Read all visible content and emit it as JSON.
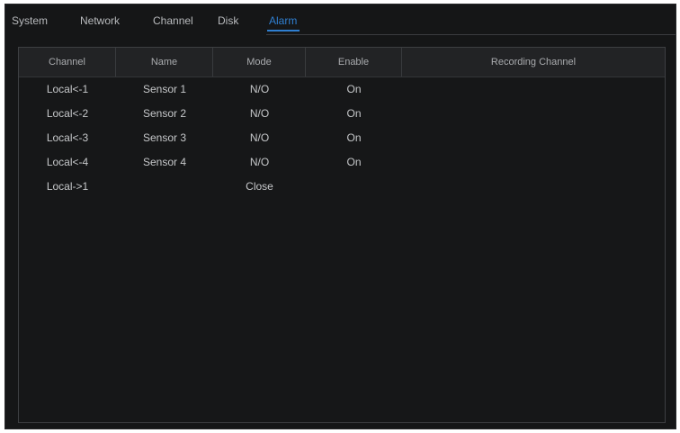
{
  "tabs": [
    {
      "label": "System",
      "active": false
    },
    {
      "label": "Network",
      "active": false
    },
    {
      "label": "Channel",
      "active": false
    },
    {
      "label": "Disk",
      "active": false
    },
    {
      "label": "Alarm",
      "active": true
    }
  ],
  "table": {
    "headers": [
      "Channel",
      "Name",
      "Mode",
      "Enable",
      "Recording Channel"
    ],
    "rows": [
      {
        "channel": "Local<-1",
        "name": "Sensor 1",
        "mode": "N/O",
        "enable": "On",
        "recording_channel": ""
      },
      {
        "channel": "Local<-2",
        "name": "Sensor 2",
        "mode": "N/O",
        "enable": "On",
        "recording_channel": ""
      },
      {
        "channel": "Local<-3",
        "name": "Sensor 3",
        "mode": "N/O",
        "enable": "On",
        "recording_channel": ""
      },
      {
        "channel": "Local<-4",
        "name": "Sensor 4",
        "mode": "N/O",
        "enable": "On",
        "recording_channel": ""
      },
      {
        "channel": "Local->1",
        "name": "",
        "mode": "Close",
        "enable": "",
        "recording_channel": ""
      }
    ]
  },
  "colors": {
    "accent": "#2f7fd1",
    "background": "#151617",
    "header_background": "#222325",
    "text": "#c6c8ca"
  }
}
